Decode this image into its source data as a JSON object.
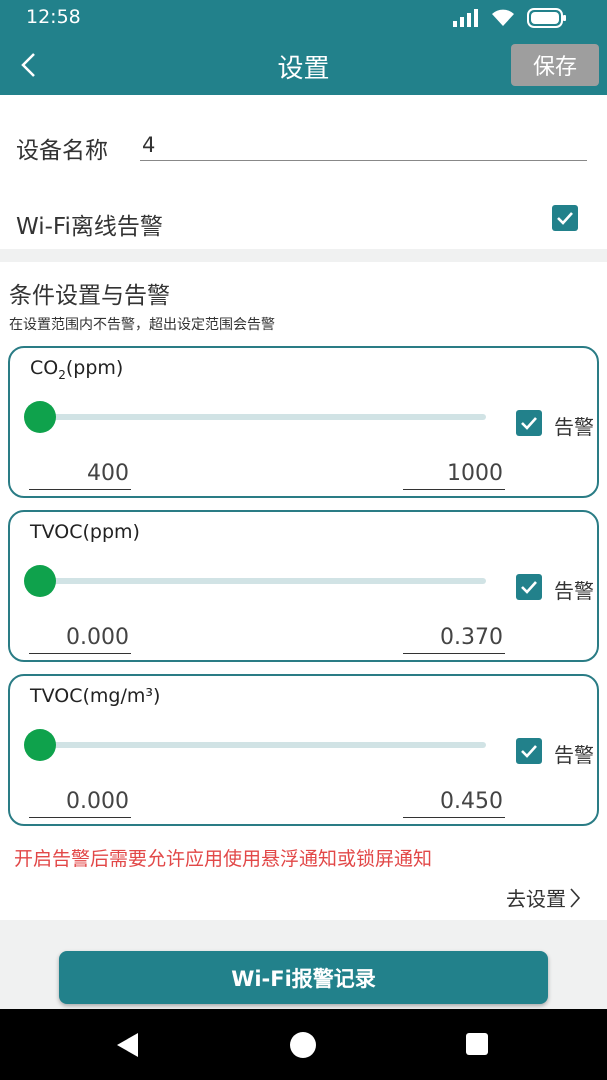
{
  "status_bar": {
    "time": "12:58"
  },
  "app_bar": {
    "title": "设置",
    "save_label": "保存"
  },
  "device": {
    "name_label": "设备名称",
    "name_value": "4"
  },
  "wifi_offline": {
    "label": "Wi-Fi离线告警",
    "checked": true
  },
  "conditions": {
    "title": "条件设置与告警",
    "subtitle": "在设置范围内不告警，超出设定范围会告警",
    "alarm_label": "告警",
    "sensors": [
      {
        "label_base": "CO",
        "label_sub": "2",
        "label_suffix": "(ppm)",
        "min": "400",
        "max": "1000",
        "alarm": true
      },
      {
        "label": "TVOC(ppm)",
        "min": "0.000",
        "max": "0.370",
        "alarm": true
      },
      {
        "label": "TVOC(mg/m³)",
        "min": "0.000",
        "max": "0.450",
        "alarm": true
      }
    ]
  },
  "warning_text": "开启告警后需要允许应用使用悬浮通知或锁屏通知",
  "go_settings_label": "去设置",
  "records_button_label": "Wi-Fi报警记录",
  "colors": {
    "primary": "#22818b",
    "thumb": "#0fa24c",
    "warning": "#e24848",
    "save_bg": "#9e9e9e"
  }
}
